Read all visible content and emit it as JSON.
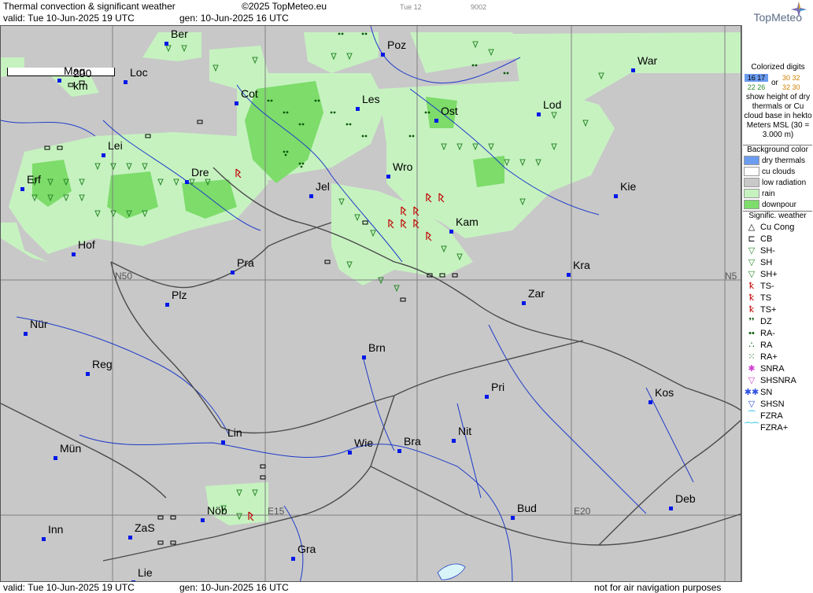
{
  "header": {
    "title": "Thermal convection & significant weather",
    "copyright": "©2025 TopMeteo.eu",
    "valid": "valid:  Tue  10-Jun-2025  19 UTC",
    "generated": "gen: 10-Jun-2025 16 UTC",
    "day_tag": "Tue 12",
    "code": "9002",
    "logo": "TopMeteo"
  },
  "map": {
    "scale_label": "200 km",
    "grid_labels": [
      "N50",
      "N5",
      "E15",
      "E20"
    ],
    "cities": [
      "Ber",
      "Poz",
      "War",
      "Mag",
      "Loc",
      "Cot",
      "Les",
      "Ost",
      "Lod",
      "Lei",
      "Erf",
      "Dre",
      "Wro",
      "Jel",
      "Kie",
      "Kam",
      "Hof",
      "Pra",
      "Kra",
      "Plz",
      "Zar",
      "Nür",
      "Brn",
      "Reg",
      "Pri",
      "Kos",
      "Lin",
      "Nit",
      "Mün",
      "Wie",
      "Bra",
      "Deb",
      "Nöb",
      "Bud",
      "Inn",
      "ZaS",
      "Gra",
      "Lie"
    ]
  },
  "legend": {
    "digits_title": "Colorized digits",
    "digits_examples": [
      "16 17",
      "22 26",
      "30 32",
      "32 30"
    ],
    "digits_or": "or",
    "digits_desc": "show height of dry thermals or Cu cloud base in hekto Meters MSL (30 = 3.000 m)",
    "bg_title": "Background color",
    "bg_items": [
      {
        "label": "dry thermals",
        "color": "#6b9cf0"
      },
      {
        "label": "cu clouds",
        "color": "#ffffff"
      },
      {
        "label": "low radiation",
        "color": "#c8c8c8"
      },
      {
        "label": "rain",
        "color": "#c6f2c0"
      },
      {
        "label": "downpour",
        "color": "#7ddc6a"
      }
    ],
    "wx_title": "Signific. weather",
    "wx_items": [
      {
        "label": "Cu Cong",
        "symbol": "△",
        "color": "#000000"
      },
      {
        "label": "CB",
        "symbol": "⊏",
        "color": "#000000"
      },
      {
        "label": "SH-",
        "symbol": "▽",
        "color": "#2a8a2a"
      },
      {
        "label": "SH",
        "symbol": "▽",
        "color": "#2a8a2a"
      },
      {
        "label": "SH+",
        "symbol": "▽",
        "color": "#2a8a2a"
      },
      {
        "label": "TS-",
        "symbol": "ꝁ",
        "color": "#c00000"
      },
      {
        "label": "TS",
        "symbol": "ꝁ",
        "color": "#c00000"
      },
      {
        "label": "TS+",
        "symbol": "ꝁ",
        "color": "#c00000"
      },
      {
        "label": "DZ",
        "symbol": "❜❜",
        "color": "#0b5a0b"
      },
      {
        "label": "RA-",
        "symbol": "••",
        "color": "#0b5a0b"
      },
      {
        "label": "RA",
        "symbol": "∴",
        "color": "#0b5a0b"
      },
      {
        "label": "RA+",
        "symbol": "⁙",
        "color": "#0b5a0b"
      },
      {
        "label": "SNRA",
        "symbol": "✱",
        "color": "#d040d0"
      },
      {
        "label": "SHSNRA",
        "symbol": "▽",
        "color": "#d040d0"
      },
      {
        "label": "SN",
        "symbol": "✱✱",
        "color": "#3050e0"
      },
      {
        "label": "SHSN",
        "symbol": "▽",
        "color": "#3050e0"
      },
      {
        "label": "FZRA",
        "symbol": "⁀",
        "color": "#20c0e0"
      },
      {
        "label": "FZRA+",
        "symbol": "⁀⁀",
        "color": "#20c0e0"
      }
    ]
  },
  "footer": {
    "valid": "valid:  Tue  10-Jun-2025  19 UTC",
    "generated": "gen: 10-Jun-2025 16 UTC",
    "disclaimer": "not for air navigation purposes"
  }
}
